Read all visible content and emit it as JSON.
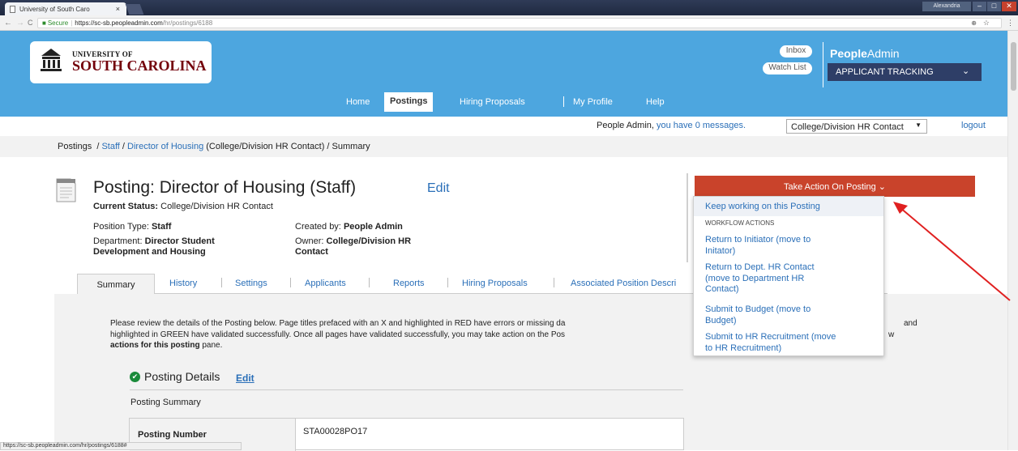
{
  "browser": {
    "tab_title": "University of South Caro",
    "tab_close": "×",
    "user": "Alexandria",
    "secure_label": "Secure",
    "url_host": "https://sc-sb.peopleadmin.com",
    "url_path": "/hr/postings/6188",
    "status_url": "https://sc-sb.peopleadmin.com/hr/postings/6188#"
  },
  "header": {
    "logo_line1": "UNIVERSITY OF",
    "logo_line2": "SOUTH CAROLINA",
    "inbox": "Inbox",
    "watch_list": "Watch List",
    "brand_people": "People",
    "brand_admin": "Admin",
    "module": "APPLICANT TRACKING",
    "nav": {
      "home": "Home",
      "postings": "Postings",
      "hiring_proposals": "Hiring Proposals",
      "my_profile": "My Profile",
      "help": "Help"
    }
  },
  "messages": {
    "prefix": "People Admin,",
    "link": "you have 0 messages.",
    "role": "College/Division HR Contact",
    "logout": "logout"
  },
  "breadcrumb": {
    "postings": "Postings",
    "staff": "Staff",
    "posting": "Director of Housing",
    "suffix": "(College/Division HR Contact)",
    "current": "Summary"
  },
  "posting": {
    "title": "Posting: Director of Housing (Staff)",
    "edit": "Edit",
    "status_label": "Current Status:",
    "status_value": "College/Division HR Contact",
    "position_type_label": "Position Type:",
    "position_type": "Staff",
    "department_label": "Department:",
    "department_line1": "Director Student",
    "department_line2": "Development and Housing",
    "created_by_label": "Created by:",
    "created_by": "People Admin",
    "owner_label": "Owner:",
    "owner_line1": "College/Division HR",
    "owner_line2": "Contact"
  },
  "tabs": [
    "Summary",
    "History",
    "Settings",
    "Applicants",
    "Reports",
    "Hiring Proposals",
    "Associated Position Descri"
  ],
  "intro": {
    "line1": "Please review the details of the Posting below.  Page titles prefaced with an X and highlighted in RED have errors or missing da",
    "line1_end": "and",
    "line2": "highlighted in GREEN have validated successfully.  Once all pages have validated successfully, you may take action on the Pos",
    "line2_end": "w",
    "line3": "actions for this posting",
    "line3_rest": "pane."
  },
  "details": {
    "section_title": "Posting Details",
    "edit": "Edit",
    "summary_label": "Posting Summary",
    "posting_number_label": "Posting Number",
    "posting_number": "STA00028PO17"
  },
  "action": {
    "button": "Take Action On Posting",
    "keep_working": "Keep working on this Posting",
    "workflow_header": "WORKFLOW ACTIONS",
    "items": [
      {
        "line1": "Return to Initiator (move to",
        "line2": "Initator)"
      },
      {
        "line1": "Return to Dept. HR Contact",
        "line2": "(move to Department HR",
        "line3": "Contact)"
      },
      {
        "line1": "Submit to Budget (move to",
        "line2": "Budget)"
      },
      {
        "line1": "Submit to HR Recruitment (move",
        "line2": "to HR Recruitment)"
      }
    ]
  },
  "colors": {
    "banner": "#4da6df",
    "module_bg": "#2e3e67",
    "action_red": "#c9432b",
    "link_blue": "#2a6fb8",
    "annotation_arrow": "#e02020"
  }
}
